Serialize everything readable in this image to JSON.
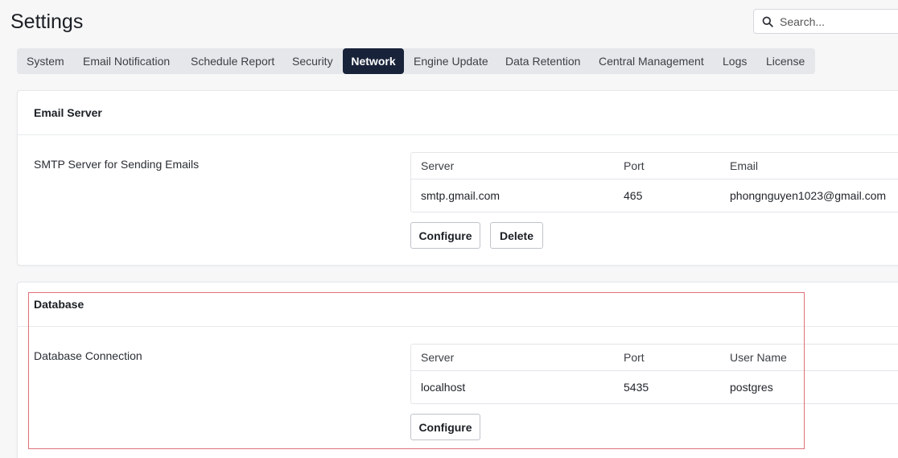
{
  "header": {
    "title": "Settings",
    "search_placeholder": "Search..."
  },
  "tabs": [
    {
      "label": "System",
      "active": false
    },
    {
      "label": "Email Notification",
      "active": false
    },
    {
      "label": "Schedule Report",
      "active": false
    },
    {
      "label": "Security",
      "active": false
    },
    {
      "label": "Network",
      "active": true
    },
    {
      "label": "Engine Update",
      "active": false
    },
    {
      "label": "Data Retention",
      "active": false
    },
    {
      "label": "Central Management",
      "active": false
    },
    {
      "label": "Logs",
      "active": false
    },
    {
      "label": "License",
      "active": false
    }
  ],
  "email_server": {
    "title": "Email Server",
    "row_label": "SMTP Server for Sending Emails",
    "columns": [
      "Server",
      "Port",
      "Email"
    ],
    "row": [
      "smtp.gmail.com",
      "465",
      "phongnguyen1023@gmail.com"
    ],
    "configure_label": "Configure",
    "delete_label": "Delete"
  },
  "database": {
    "title": "Database",
    "row_label": "Database Connection",
    "columns": [
      "Server",
      "Port",
      "User Name"
    ],
    "row": [
      "localhost",
      "5435",
      "postgres"
    ],
    "configure_label": "Configure"
  },
  "colors": {
    "active_tab_bg": "#18233a",
    "highlight_border": "#e0707a"
  }
}
